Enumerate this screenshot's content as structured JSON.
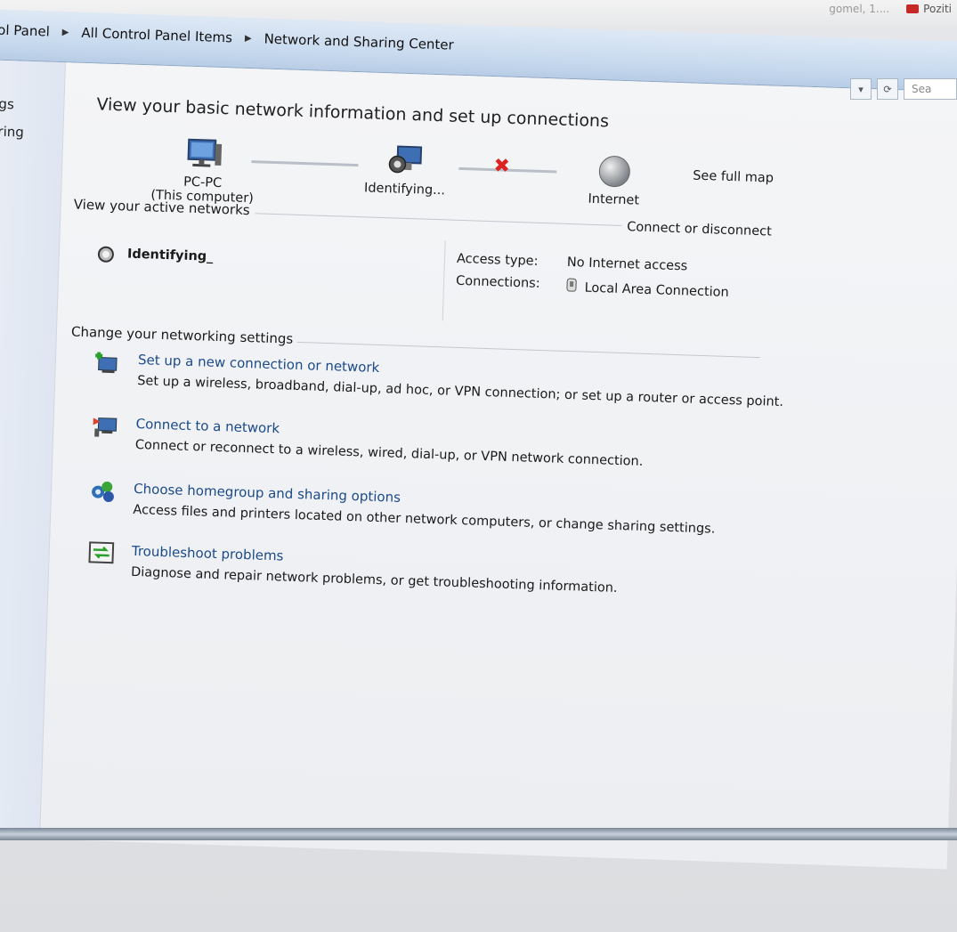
{
  "top_strip": {
    "faint_text": "gomel, 1....",
    "tab_label": "Poziti"
  },
  "address_bar": {
    "crumbs": [
      "ol Panel",
      "All Control Panel Items",
      "Network and Sharing Center"
    ],
    "refresh_glyph": "⟳",
    "dropdown_glyph": "▾",
    "search_placeholder": "Sea"
  },
  "left_pane": {
    "items": [
      "gs",
      "ring"
    ]
  },
  "main": {
    "title": "View your basic network information and set up connections",
    "map": {
      "computer_name": "PC-PC",
      "computer_sub": "(This computer)",
      "network_label": "Identifying...",
      "internet_label": "Internet",
      "see_full_map": "See full map",
      "break_glyph": "✖"
    },
    "active_networks": {
      "section_title": "View your active networks",
      "connect_link": "Connect or disconnect",
      "network_name": "Identifying_",
      "access_type_label": "Access type:",
      "access_type_value": "No Internet access",
      "connections_label": "Connections:",
      "connections_value": "Local Area Connection"
    },
    "change_settings": {
      "section_title": "Change your networking settings",
      "tasks": [
        {
          "title": "Set up a new connection or network",
          "desc": "Set up a wireless, broadband, dial-up, ad hoc, or VPN connection; or set up a router or access point.",
          "icon": "new-connection-icon"
        },
        {
          "title": "Connect to a network",
          "desc": "Connect or reconnect to a wireless, wired, dial-up, or VPN network connection.",
          "icon": "connect-network-icon"
        },
        {
          "title": "Choose homegroup and sharing options",
          "desc": "Access files and printers located on other network computers, or change sharing settings.",
          "icon": "homegroup-icon"
        },
        {
          "title": "Troubleshoot problems",
          "desc": "Diagnose and repair network problems, or get troubleshooting information.",
          "icon": "troubleshoot-icon"
        }
      ]
    }
  },
  "colors": {
    "link": "#1b4a8a",
    "error": "#d22222",
    "addressbar": "#c9dbef"
  }
}
